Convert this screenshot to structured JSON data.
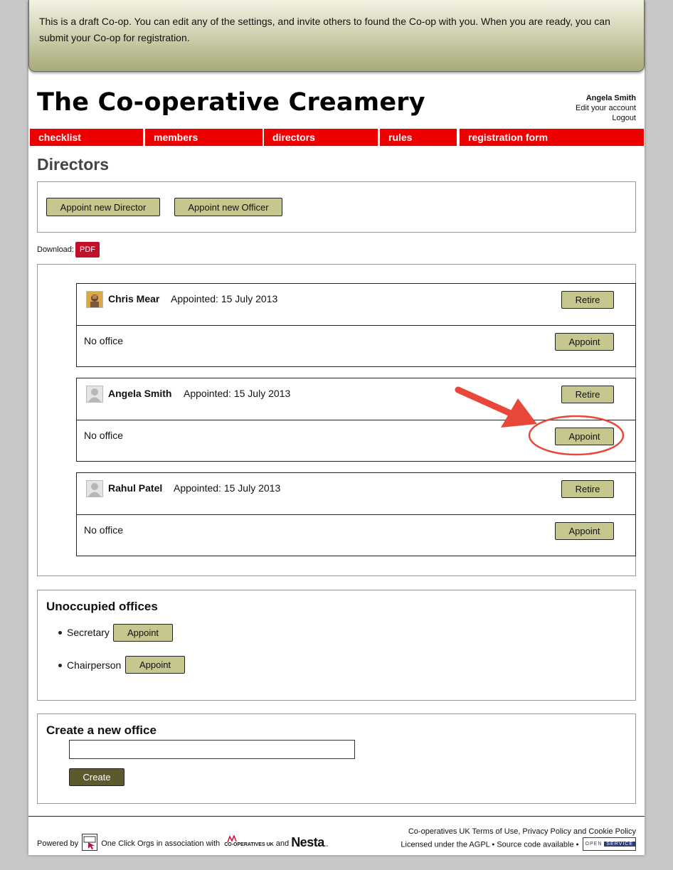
{
  "banner": {
    "text": "This is a draft Co-op. You can edit any of the settings, and invite others to found the Co-op with you. When you are ready, you can submit your Co-op for registration."
  },
  "header": {
    "title": "The Co-operative Creamery",
    "user_name": "Angela Smith",
    "edit_account": "Edit your account",
    "logout": "Logout"
  },
  "nav": {
    "tabs": [
      {
        "label": "checklist"
      },
      {
        "label": "members"
      },
      {
        "label": "directors"
      },
      {
        "label": "rules"
      },
      {
        "label": "registration form"
      }
    ],
    "color": "#ee0000"
  },
  "page": {
    "heading": "Directors",
    "appoint_director": "Appoint new Director",
    "appoint_officer": "Appoint new Officer",
    "download_label": "Download:",
    "pdf_label": "PDF"
  },
  "directors": [
    {
      "name": "Chris Mear",
      "appointed": "Appointed: 15 July 2013",
      "office": "No office",
      "retire": "Retire",
      "appoint": "Appoint",
      "avatar": "photo-avatar"
    },
    {
      "name": "Angela Smith",
      "appointed": "Appointed: 15 July 2013",
      "office": "No office",
      "retire": "Retire",
      "appoint": "Appoint",
      "avatar": "default-user-avatar"
    },
    {
      "name": "Rahul Patel",
      "appointed": "Appointed: 15 July 2013",
      "office": "No office",
      "retire": "Retire",
      "appoint": "Appoint",
      "avatar": "default-user-avatar"
    }
  ],
  "unoccupied": {
    "heading": "Unoccupied offices",
    "offices": [
      {
        "name": "Secretary",
        "appoint": "Appoint"
      },
      {
        "name": "Chairperson",
        "appoint": "Appoint"
      }
    ]
  },
  "create_office": {
    "heading": "Create a new office",
    "input_value": "",
    "button": "Create"
  },
  "footer": {
    "powered_by": "Powered by",
    "oco_name": "One Click Orgs",
    "association": "in association with",
    "coops_uk_logo": "CO-OPERATIVES UK",
    "and": "and",
    "nesta": "Nesta",
    "terms_line": "Co-operatives UK Terms of Use, Privacy Policy and Cookie Policy",
    "license_line": "Licensed under the AGPL • Source code available •",
    "open_service_1": "OPEN",
    "open_service_2": "SERVICE"
  },
  "colors": {
    "button": "#c6c78e",
    "pdf": "#c0102a",
    "annotation": "#e8483a"
  }
}
